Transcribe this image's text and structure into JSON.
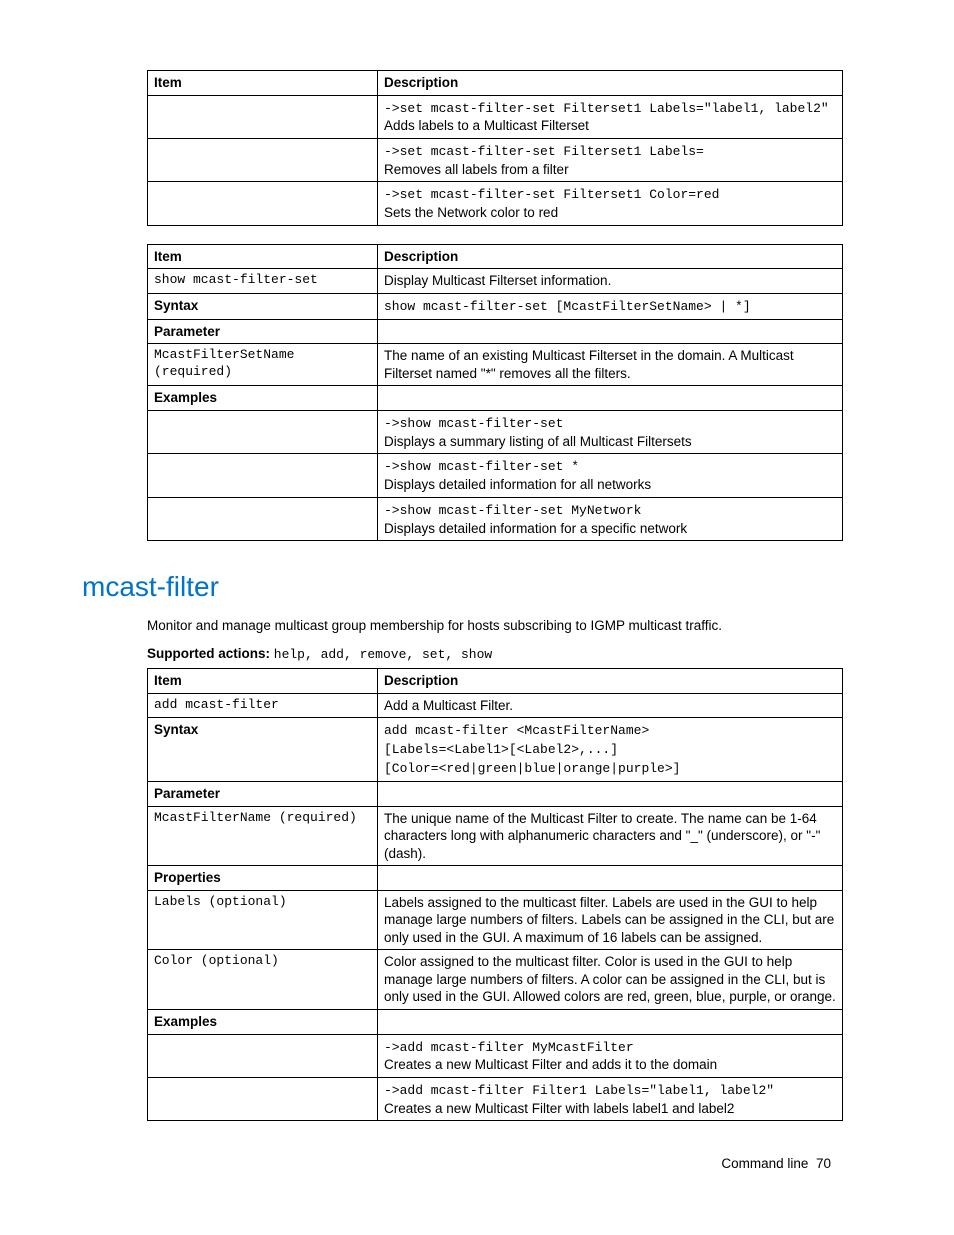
{
  "table1": {
    "headers": [
      "Item",
      "Description"
    ],
    "rows": [
      {
        "col1": "",
        "cmd": "->set mcast-filter-set Filterset1 Labels=\"label1, label2\"",
        "desc": "Adds labels to a Multicast Filterset"
      },
      {
        "col1": "",
        "cmd": "->set mcast-filter-set Filterset1 Labels=",
        "desc": "Removes all labels from a filter"
      },
      {
        "col1": "",
        "cmd": "->set mcast-filter-set Filterset1 Color=red",
        "desc": "Sets the Network color to red"
      }
    ]
  },
  "table2": {
    "headers": [
      "Item",
      "Description"
    ],
    "rows": [
      {
        "col1_style": "mono",
        "col1": "show mcast-filter-set",
        "desc": "Display Multicast Filterset information."
      },
      {
        "col1_style": "bold",
        "col1": "Syntax",
        "cmdplain": "show mcast-filter-set [McastFilterSetName> | *]"
      },
      {
        "col1_style": "bold",
        "col1": "Parameter",
        "desc": ""
      },
      {
        "col1_style": "mono",
        "col1": "McastFilterSetName (required)",
        "desc": "The name of an existing Multicast Filterset in the domain. A Multicast Filterset named \"*\" removes all the filters."
      },
      {
        "col1_style": "bold",
        "col1": "Examples",
        "desc": ""
      },
      {
        "col1": "",
        "cmd": "->show mcast-filter-set",
        "desc": "Displays a summary listing of all Multicast Filtersets"
      },
      {
        "col1": "",
        "cmd": "->show mcast-filter-set *",
        "desc": "Displays detailed information for all networks"
      },
      {
        "col1": "",
        "cmd": "->show mcast-filter-set MyNetwork",
        "desc": "Displays detailed information for a specific network"
      }
    ]
  },
  "heading": "mcast-filter",
  "intro": "Monitor and manage multicast group membership for hosts subscribing to IGMP multicast traffic.",
  "supported_label": "Supported actions",
  "supported_actions": "help, add, remove, set, show",
  "table3": {
    "headers": [
      "Item",
      "Description"
    ],
    "rows": [
      {
        "col1_style": "mono",
        "col1": "add mcast-filter",
        "desc": "Add a Multicast Filter."
      },
      {
        "col1_style": "bold",
        "col1": "Syntax",
        "cmdplain": "add mcast-filter <McastFilterName>\n[Labels=<Label1>[<Label2>,...]\n[Color=<red|green|blue|orange|purple>]"
      },
      {
        "col1_style": "bold",
        "col1": "Parameter",
        "desc": ""
      },
      {
        "col1_style": "mono",
        "col1": "McastFilterName (required)",
        "desc": "The unique name of the Multicast Filter to create. The name can be 1-64 characters long with alphanumeric characters and \"_\" (underscore), or \"-\" (dash)."
      },
      {
        "col1_style": "bold",
        "col1": "Properties",
        "desc": ""
      },
      {
        "col1_style": "mono",
        "col1": "Labels (optional)",
        "desc": "Labels assigned to the multicast filter. Labels are used in the GUI to help manage large numbers of filters. Labels can be assigned in the CLI, but are only used in the GUI. A maximum of 16 labels can be assigned."
      },
      {
        "col1_style": "mono",
        "col1": "Color (optional)",
        "desc": "Color assigned to the multicast filter. Color is used in the GUI to help manage large numbers of filters. A color can be assigned in the CLI, but is only used in the GUI. Allowed colors are red, green, blue, purple, or orange."
      },
      {
        "col1_style": "bold",
        "col1": "Examples",
        "desc": ""
      },
      {
        "col1": "",
        "cmd": "->add mcast-filter MyMcastFilter",
        "desc": "Creates a new Multicast Filter and adds it to the domain"
      },
      {
        "col1": "",
        "cmd": "->add mcast-filter Filter1 Labels=\"label1, label2\"",
        "desc": "Creates a new Multicast Filter with labels label1 and label2"
      }
    ]
  },
  "footer_text": "Command line",
  "footer_page": "70"
}
